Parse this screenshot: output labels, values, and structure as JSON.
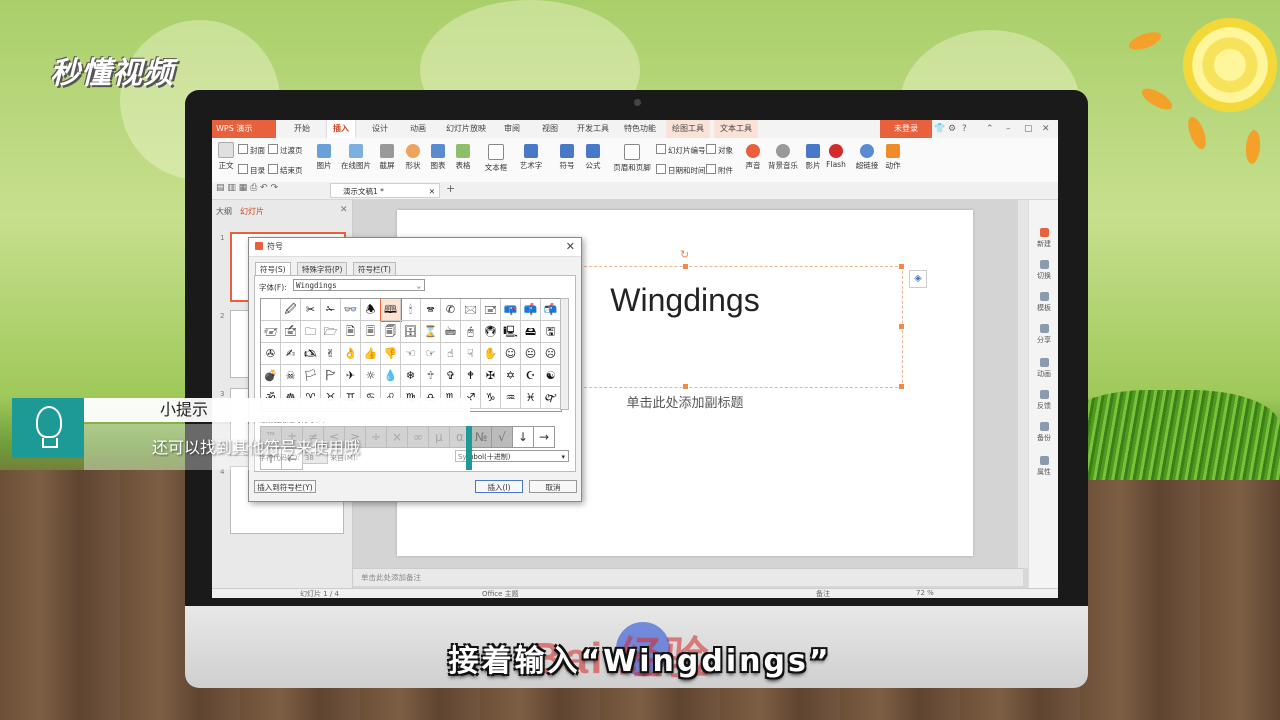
{
  "brand": {
    "logo_text": "秒懂视频"
  },
  "app": {
    "name": "WPS 演示",
    "tabs": [
      "开始",
      "插入",
      "设计",
      "动画",
      "幻灯片放映",
      "审阅",
      "视图",
      "开发工具",
      "特色功能",
      "绘图工具",
      "文本工具"
    ],
    "active_tab": "插入",
    "login_label": "未登录"
  },
  "ribbon": {
    "small_left": [
      "封面",
      "过渡页",
      "目录",
      "结束页"
    ],
    "zhengwen": "正文",
    "buttons": [
      "图片",
      "在线图片",
      "截屏",
      "形状",
      "图表",
      "表格",
      "文本框",
      "艺术字",
      "符号",
      "公式",
      "页眉和页脚",
      "幻灯片编号",
      "对象",
      "日期和时间",
      "附件",
      "声音",
      "背景音乐",
      "影片",
      "Flash",
      "超链接",
      "动作"
    ]
  },
  "document": {
    "tab_title": "演示文稿1 *"
  },
  "left_panel": {
    "tab_outline": "大纲",
    "tab_slides": "幻灯片",
    "slide_numbers": [
      "1",
      "2",
      "3",
      "4"
    ]
  },
  "slide": {
    "title": "Wingdings",
    "subtitle": "单击此处添加副标题",
    "notes_placeholder": "单击此处添加备注"
  },
  "status": {
    "slide_info": "幻灯片 1 / 4",
    "theme": "Office 主题",
    "notes_label": "备注",
    "zoom": "72 %"
  },
  "right_bar": [
    "新建",
    "切换",
    "模板",
    "分享",
    "动画",
    "反馈",
    "备份",
    "属性"
  ],
  "symbol_dialog": {
    "title": "符号",
    "tabs": [
      "符号(S)",
      "特殊字符(P)",
      "符号栏(T)"
    ],
    "font_label": "字体(F):",
    "font_value": "Wingdings",
    "symbols": [
      " ",
      "🖉",
      "✂",
      "✁",
      "👓",
      "🕭",
      "🕮",
      "🕯",
      "🕿",
      "✆",
      "🖂",
      "🖃",
      "📪",
      "📫",
      "📬",
      "🖅",
      "🖆",
      "🗀",
      "🗁",
      "🗎",
      "🗏",
      "🗐",
      "🗄",
      "⌛",
      "🖮",
      "🖰",
      "🖲",
      "🖳",
      "🖴",
      "🖫",
      "✇",
      "✍",
      "🖎",
      "✌",
      "👌",
      "👍",
      "👎",
      "☜",
      "☞",
      "☝",
      "☟",
      "✋",
      "☺",
      "😐",
      "☹",
      "💣",
      "☠",
      "🏳",
      "🏱",
      "✈",
      "☼",
      "💧",
      "❄",
      "🕆",
      "✞",
      "🕈",
      "✠",
      "✡",
      "☪",
      "☯",
      "ॐ",
      "☸",
      "♈",
      "♉",
      "♊",
      "♋",
      "♌",
      "♍",
      "♎",
      "♏",
      "♐",
      "♑",
      "♒",
      "♓",
      "🙰"
    ],
    "recent_label": "近期使用过的符号(R):",
    "recent": [
      "™",
      "±",
      "≠",
      "≤",
      "≥",
      "÷",
      "×",
      "∞",
      "µ",
      "α",
      "№",
      "√",
      "↓",
      "→",
      "↑",
      "←"
    ],
    "code_label": "字符代码(C):",
    "code_value": "38",
    "from_label": "来自(M):",
    "from_value": "Symbol(十进制)",
    "insert_to_bar": "插入到符号栏(Y)",
    "insert": "插入(I)",
    "cancel": "取消"
  },
  "tip": {
    "heading": "小提示",
    "text": "还可以找到其他符号来使用哦"
  },
  "caption": "接着输入“Wingdings”",
  "watermark": "Bai 经验"
}
